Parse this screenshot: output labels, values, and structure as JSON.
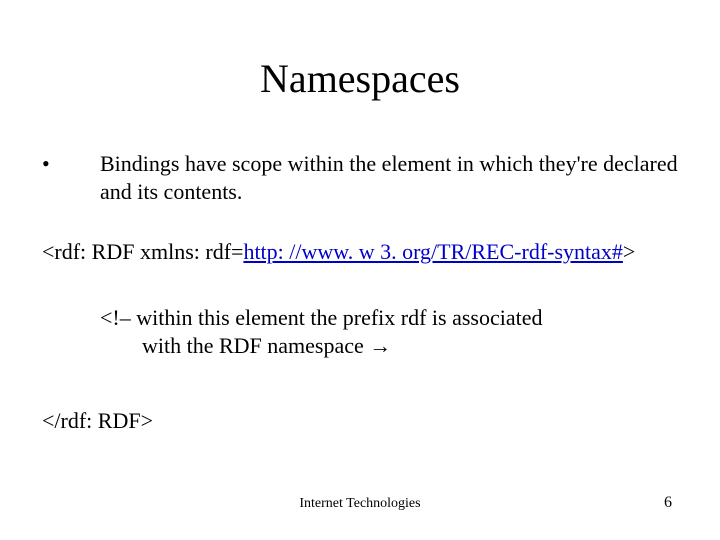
{
  "title": "Namespaces",
  "bullet": {
    "mark": "•",
    "text": "Bindings have scope within the element in which they're declared and its contents."
  },
  "code": {
    "open_prefix": "<rdf: RDF xmlns: rdf=",
    "open_link": "http: //www. w 3. org/TR/REC-rdf-syntax#",
    "open_suffix": ">",
    "comment_l1": "<!– within this element the prefix rdf is associated",
    "comment_l2": "with the RDF namespace →",
    "close": "</rdf: RDF>"
  },
  "footer": {
    "center": "Internet Technologies",
    "page": "6"
  }
}
